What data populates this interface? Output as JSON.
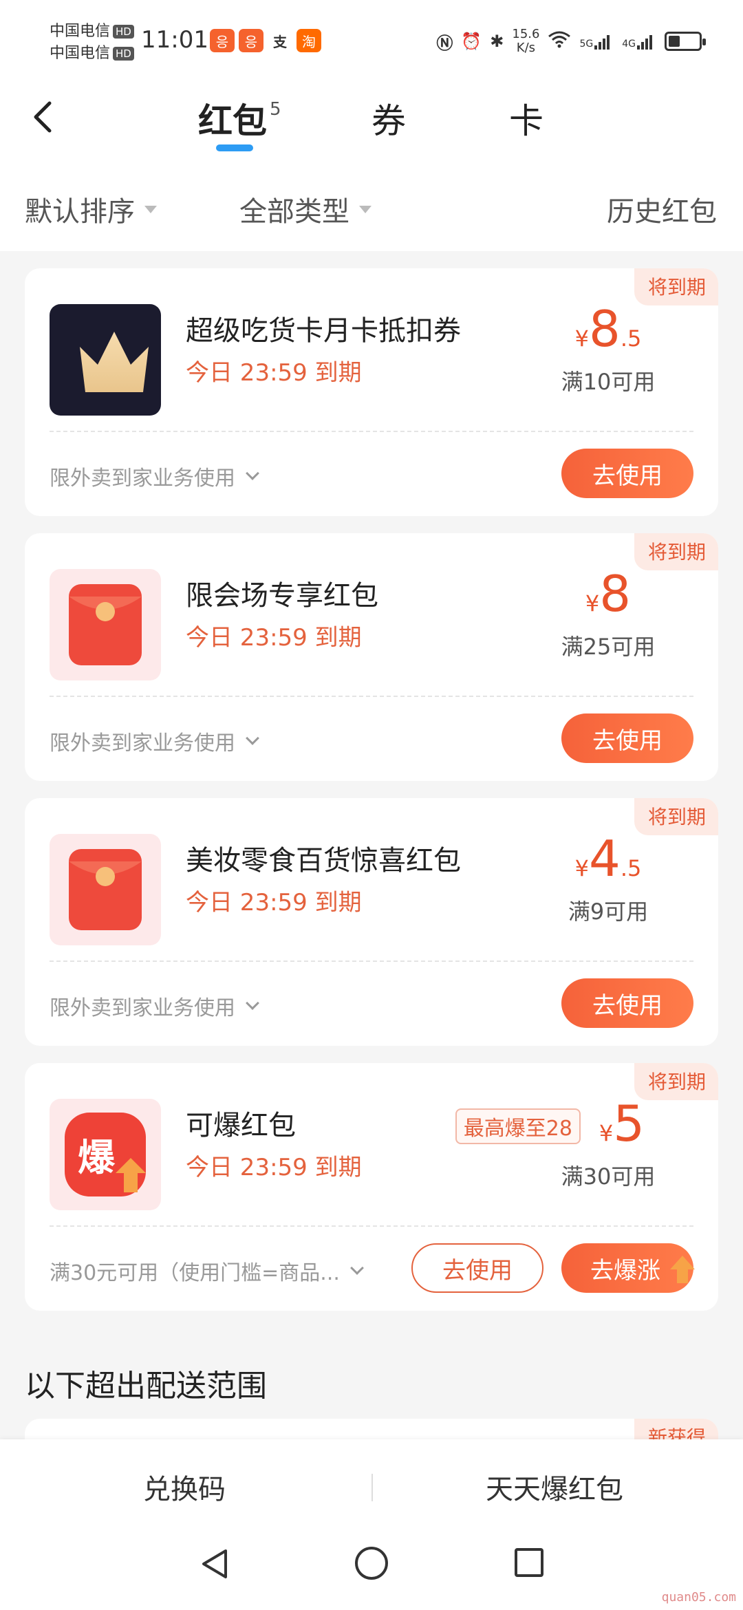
{
  "status_bar": {
    "carrier_1": "中国电信",
    "carrier_2": "中国电信",
    "hd_label": "HD",
    "time": "11:01",
    "app_icons": [
      {
        "name": "meituan-icon",
        "glyph": "응",
        "color": "#f5622d"
      },
      {
        "name": "meituan-icon-2",
        "glyph": "응",
        "color": "#f5622d"
      },
      {
        "name": "alipay-icon",
        "glyph": "支",
        "color": "#ffffff"
      },
      {
        "name": "taobao-icon",
        "glyph": "淘",
        "color": "#ff6a00"
      }
    ],
    "net_speed_value": "15.6",
    "net_speed_unit": "K/s",
    "signal_1": "5G",
    "signal_2": "4G"
  },
  "header": {
    "tabs": [
      {
        "label": "红包",
        "count": "5"
      },
      {
        "label": "券"
      },
      {
        "label": "卡"
      }
    ]
  },
  "filters": {
    "sort": "默认排序",
    "type": "全部类型",
    "history": "历史红包"
  },
  "cards": [
    {
      "badge": "将到期",
      "title": "超级吃货卡月卡抵扣券",
      "expire": "今日 23:59 到期",
      "currency": "¥",
      "amount": "8",
      "amount_decimal": ".5",
      "threshold": "满10可用",
      "scope": "限外卖到家业务使用",
      "button": "去使用",
      "icon": "crown-icon"
    },
    {
      "badge": "将到期",
      "title": "限会场专享红包",
      "expire": "今日 23:59 到期",
      "currency": "¥",
      "amount": "8",
      "amount_decimal": "",
      "threshold": "满25可用",
      "scope": "限外卖到家业务使用",
      "button": "去使用",
      "icon": "red-envelope-icon"
    },
    {
      "badge": "将到期",
      "title": "美妆零食百货惊喜红包",
      "expire": "今日 23:59 到期",
      "currency": "¥",
      "amount": "4",
      "amount_decimal": ".5",
      "threshold": "满9可用",
      "scope": "限外卖到家业务使用",
      "button": "去使用",
      "icon": "red-envelope-icon"
    },
    {
      "badge": "将到期",
      "title": "可爆红包",
      "expire": "今日 23:59 到期",
      "boom_tag": "最高爆至28",
      "currency": "¥",
      "amount": "5",
      "amount_decimal": "",
      "threshold": "满30可用",
      "scope": "满30元可用（使用门槛=商品...",
      "button_outline": "去使用",
      "button": "去爆涨",
      "icon_glyph": "爆",
      "icon": "boom-envelope-icon"
    }
  ],
  "section_title": "以下超出配送范围",
  "peek_badge": "新获得",
  "bottom_bar": {
    "left": "兑换码",
    "right": "天天爆红包"
  },
  "watermark": "quan05.com",
  "colors": {
    "accent": "#e8532b",
    "tab_indicator": "#2d9cf4",
    "badge_bg": "#fdeae4"
  }
}
